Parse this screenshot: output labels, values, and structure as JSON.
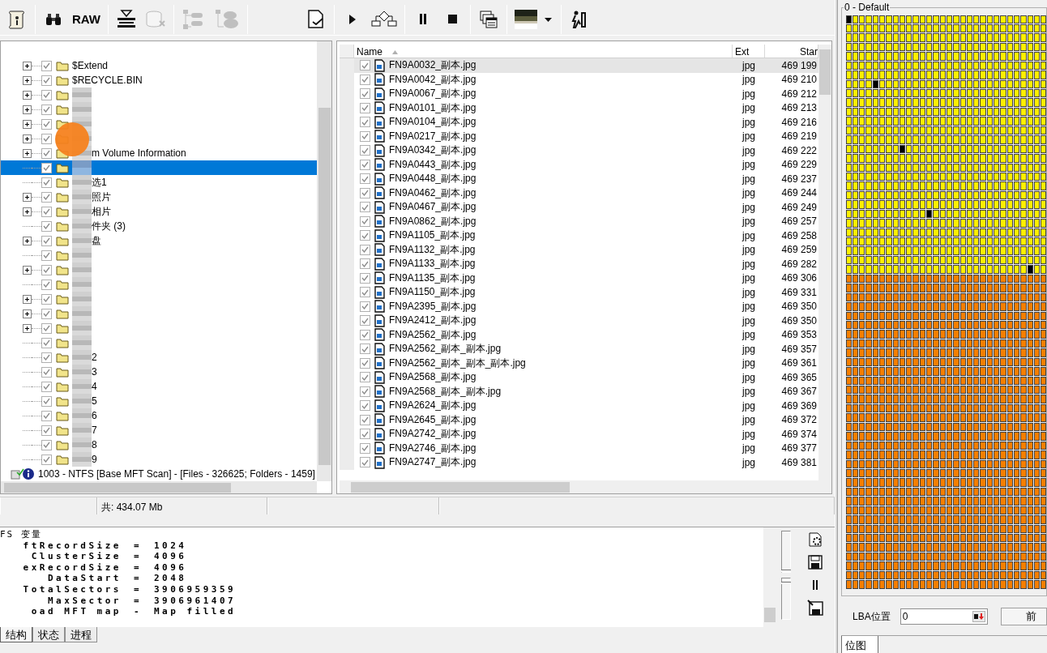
{
  "toolbar": [
    {
      "kind": "scroll",
      "disabled": false
    },
    {
      "kind": "binoculars",
      "disabled": false
    },
    {
      "kind": "text",
      "label": "RAW",
      "disabled": false
    },
    {
      "kind": "filter",
      "disabled": false
    },
    {
      "kind": "db-remove",
      "disabled": true
    },
    {
      "kind": "tree",
      "disabled": true
    },
    {
      "kind": "tree-cloud",
      "disabled": true
    },
    {
      "kind": "doc-check",
      "disabled": false
    },
    {
      "kind": "play",
      "disabled": false
    },
    {
      "kind": "flowchart",
      "disabled": false
    },
    {
      "kind": "pause",
      "disabled": false
    },
    {
      "kind": "stop",
      "disabled": false
    },
    {
      "kind": "windows",
      "disabled": false
    },
    {
      "kind": "thumbnail",
      "disabled": false
    },
    {
      "kind": "exit",
      "disabled": false
    }
  ],
  "tree": {
    "nodes": [
      {
        "label": "$Extend",
        "has_children": true,
        "checked": true,
        "selected": false,
        "redacted": false
      },
      {
        "label": "$RECYCLE.BIN",
        "has_children": true,
        "checked": true,
        "selected": false,
        "redacted": false
      },
      {
        "has_children": true,
        "checked": true,
        "selected": false,
        "redacted": true
      },
      {
        "has_children": true,
        "checked": true,
        "selected": false,
        "redacted": true
      },
      {
        "has_children": true,
        "checked": true,
        "selected": false,
        "redacted": true
      },
      {
        "has_children": true,
        "checked": true,
        "selected": false,
        "redacted": true
      },
      {
        "label": "m Volume Information",
        "has_children": true,
        "checked": true,
        "selected": false,
        "redacted": true
      },
      {
        "has_children": false,
        "checked": true,
        "selected": true,
        "redacted": true
      },
      {
        "label": "选1",
        "has_children": false,
        "checked": true,
        "selected": false,
        "redacted": true
      },
      {
        "label": "照片",
        "has_children": true,
        "checked": true,
        "selected": false,
        "redacted": true
      },
      {
        "label": "相片",
        "has_children": true,
        "checked": true,
        "selected": false,
        "redacted": true
      },
      {
        "label": "件夹 (3)",
        "has_children": false,
        "checked": true,
        "selected": false,
        "redacted": true
      },
      {
        "label": "盘",
        "has_children": true,
        "checked": true,
        "selected": false,
        "redacted": true
      },
      {
        "has_children": false,
        "checked": true,
        "selected": false,
        "redacted": true
      },
      {
        "has_children": true,
        "checked": true,
        "selected": false,
        "redacted": true
      },
      {
        "has_children": false,
        "checked": true,
        "selected": false,
        "redacted": true
      },
      {
        "has_children": true,
        "checked": true,
        "selected": false,
        "redacted": true
      },
      {
        "has_children": true,
        "checked": true,
        "selected": false,
        "redacted": true
      },
      {
        "has_children": true,
        "checked": true,
        "selected": false,
        "redacted": true
      },
      {
        "has_children": false,
        "checked": true,
        "selected": false,
        "redacted": true
      },
      {
        "label": "2",
        "has_children": false,
        "checked": true,
        "selected": false,
        "redacted": true
      },
      {
        "label": "3",
        "has_children": false,
        "checked": true,
        "selected": false,
        "redacted": true
      },
      {
        "label": "4",
        "has_children": false,
        "checked": true,
        "selected": false,
        "redacted": true
      },
      {
        "label": "5",
        "has_children": false,
        "checked": true,
        "selected": false,
        "redacted": true
      },
      {
        "label": "6",
        "has_children": false,
        "checked": true,
        "selected": false,
        "redacted": true
      },
      {
        "label": "7",
        "has_children": false,
        "checked": true,
        "selected": false,
        "redacted": true
      },
      {
        "label": "8",
        "has_children": false,
        "checked": true,
        "selected": false,
        "redacted": true
      },
      {
        "label": "9",
        "has_children": false,
        "checked": true,
        "selected": false,
        "redacted": true
      }
    ],
    "next_root": {
      "label": "1003 - NTFS [Base MFT Scan] - [Files - 326625; Folders - 1459]"
    }
  },
  "files": {
    "columns": [
      {
        "label": "Name",
        "sorted": true
      },
      {
        "label": "Ext",
        "sorted": false
      },
      {
        "label": "Star",
        "sorted": false
      }
    ],
    "rows": [
      {
        "name": "FN9A0032_副本.jpg",
        "ext": "jpg",
        "start": "469 199",
        "checked": true,
        "selected": true
      },
      {
        "name": "FN9A0042_副本.jpg",
        "ext": "jpg",
        "start": "469 210",
        "checked": true,
        "selected": false
      },
      {
        "name": "FN9A0067_副本.jpg",
        "ext": "jpg",
        "start": "469 212",
        "checked": true,
        "selected": false
      },
      {
        "name": "FN9A0101_副本.jpg",
        "ext": "jpg",
        "start": "469 213",
        "checked": true,
        "selected": false
      },
      {
        "name": "FN9A0104_副本.jpg",
        "ext": "jpg",
        "start": "469 216",
        "checked": true,
        "selected": false
      },
      {
        "name": "FN9A0217_副本.jpg",
        "ext": "jpg",
        "start": "469 219",
        "checked": true,
        "selected": false
      },
      {
        "name": "FN9A0342_副本.jpg",
        "ext": "jpg",
        "start": "469 222",
        "checked": true,
        "selected": false
      },
      {
        "name": "FN9A0443_副本.jpg",
        "ext": "jpg",
        "start": "469 229",
        "checked": true,
        "selected": false
      },
      {
        "name": "FN9A0448_副本.jpg",
        "ext": "jpg",
        "start": "469 237",
        "checked": true,
        "selected": false
      },
      {
        "name": "FN9A0462_副本.jpg",
        "ext": "jpg",
        "start": "469 244",
        "checked": true,
        "selected": false
      },
      {
        "name": "FN9A0467_副本.jpg",
        "ext": "jpg",
        "start": "469 249",
        "checked": true,
        "selected": false
      },
      {
        "name": "FN9A0862_副本.jpg",
        "ext": "jpg",
        "start": "469 257",
        "checked": true,
        "selected": false
      },
      {
        "name": "FN9A1105_副本.jpg",
        "ext": "jpg",
        "start": "469 258",
        "checked": true,
        "selected": false
      },
      {
        "name": "FN9A1132_副本.jpg",
        "ext": "jpg",
        "start": "469 259",
        "checked": true,
        "selected": false
      },
      {
        "name": "FN9A1133_副本.jpg",
        "ext": "jpg",
        "start": "469 282",
        "checked": true,
        "selected": false
      },
      {
        "name": "FN9A1135_副本.jpg",
        "ext": "jpg",
        "start": "469 306",
        "checked": true,
        "selected": false
      },
      {
        "name": "FN9A1150_副本.jpg",
        "ext": "jpg",
        "start": "469 331",
        "checked": true,
        "selected": false
      },
      {
        "name": "FN9A2395_副本.jpg",
        "ext": "jpg",
        "start": "469 350",
        "checked": true,
        "selected": false
      },
      {
        "name": "FN9A2412_副本.jpg",
        "ext": "jpg",
        "start": "469 350",
        "checked": true,
        "selected": false
      },
      {
        "name": "FN9A2562_副本.jpg",
        "ext": "jpg",
        "start": "469 353",
        "checked": true,
        "selected": false
      },
      {
        "name": "FN9A2562_副本_副本.jpg",
        "ext": "jpg",
        "start": "469 357",
        "checked": true,
        "selected": false
      },
      {
        "name": "FN9A2562_副本_副本_副本.jpg",
        "ext": "jpg",
        "start": "469 361",
        "checked": true,
        "selected": false
      },
      {
        "name": "FN9A2568_副本.jpg",
        "ext": "jpg",
        "start": "469 365",
        "checked": true,
        "selected": false
      },
      {
        "name": "FN9A2568_副本_副本.jpg",
        "ext": "jpg",
        "start": "469 367",
        "checked": true,
        "selected": false
      },
      {
        "name": "FN9A2624_副本.jpg",
        "ext": "jpg",
        "start": "469 369",
        "checked": true,
        "selected": false
      },
      {
        "name": "FN9A2645_副本.jpg",
        "ext": "jpg",
        "start": "469 372",
        "checked": true,
        "selected": false
      },
      {
        "name": "FN9A2742_副本.jpg",
        "ext": "jpg",
        "start": "469 374",
        "checked": true,
        "selected": false
      },
      {
        "name": "FN9A2746_副本.jpg",
        "ext": "jpg",
        "start": "469 377",
        "checked": true,
        "selected": false
      },
      {
        "name": "FN9A2747_副本.jpg",
        "ext": "jpg",
        "start": "469 381",
        "checked": true,
        "selected": false
      }
    ]
  },
  "status_bar": {
    "total": "共: 434.07 Mb"
  },
  "log": {
    "lines": [
      {
        "kind": "header",
        "text": "FS 变量"
      },
      {
        "kind": "pair",
        "key": "ftRecordSize",
        "sep": "=",
        "value": "1024"
      },
      {
        "kind": "pair",
        "key": "ClusterSize",
        "sep": "=",
        "value": "4096"
      },
      {
        "kind": "pair",
        "key": "exRecordSize",
        "sep": "=",
        "value": "4096"
      },
      {
        "kind": "pair",
        "key": "DataStart",
        "sep": "=",
        "value": "2048"
      },
      {
        "kind": "pair",
        "key": "TotalSectors",
        "sep": "=",
        "value": "3906959359"
      },
      {
        "kind": "pair",
        "key": "MaxSector",
        "sep": "=",
        "value": "3906961407"
      },
      {
        "kind": "pair",
        "key": "oad MFT map",
        "sep": "-",
        "value": "Map filled"
      }
    ]
  },
  "log_sliders": [
    {
      "level": 0
    },
    {
      "level": 0.92
    }
  ],
  "bottom_tabs": [
    {
      "label": "结构",
      "selected": true
    },
    {
      "label": "状态",
      "selected": false
    },
    {
      "label": "进程",
      "selected": false
    }
  ],
  "map_panel": {
    "title": "0 - Default",
    "lba_label": "LBA位置",
    "lba_value": "0",
    "prev_button": "前",
    "tabs": [
      {
        "label": "位图",
        "selected": true
      }
    ]
  }
}
